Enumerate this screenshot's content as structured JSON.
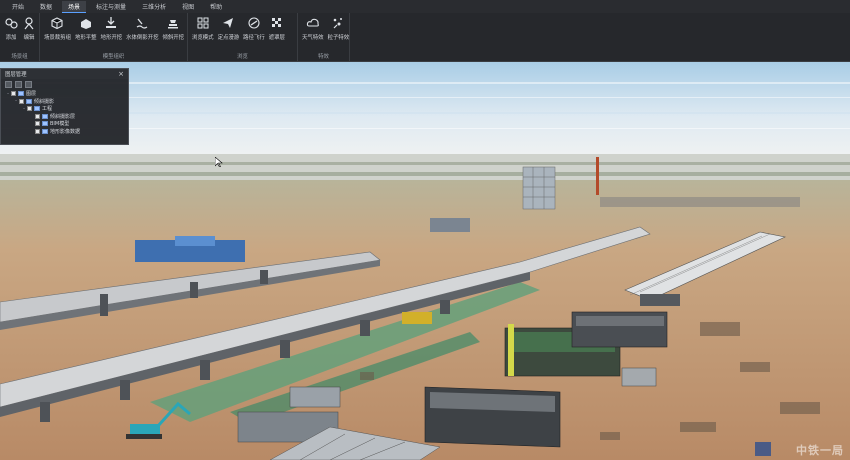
{
  "menu": {
    "tabs": [
      {
        "label": "开始",
        "active": false
      },
      {
        "label": "数据",
        "active": false
      },
      {
        "label": "场景",
        "active": true
      },
      {
        "label": "标注与测量",
        "active": false
      },
      {
        "label": "三维分析",
        "active": false
      },
      {
        "label": "视图",
        "active": false
      },
      {
        "label": "帮助",
        "active": false
      }
    ]
  },
  "ribbon": {
    "groups": [
      {
        "label": "场景组",
        "tools": [
          {
            "label": "添加",
            "icon": "add-scene-icon"
          },
          {
            "label": "编辑",
            "icon": "edit-scene-icon"
          }
        ]
      },
      {
        "label": "模型组织",
        "tools": [
          {
            "label": "场景裁剪组",
            "icon": "cube-clip-icon"
          },
          {
            "label": "地形平整",
            "icon": "terrain-flatten-icon"
          },
          {
            "label": "地形开挖",
            "icon": "terrain-excavate-icon"
          },
          {
            "label": "水体倒影开挖",
            "icon": "water-excavate-icon"
          },
          {
            "label": "倾斜开挖",
            "icon": "oblique-excavate-icon"
          }
        ]
      },
      {
        "label": "浏览",
        "tools": [
          {
            "label": "浏览模式",
            "icon": "browse-mode-icon"
          },
          {
            "label": "定点漫游",
            "icon": "point-roam-icon"
          },
          {
            "label": "路径飞行",
            "icon": "path-flight-icon"
          },
          {
            "label": "遮罩层",
            "icon": "mask-layer-icon"
          }
        ]
      },
      {
        "label": "特效",
        "tools": [
          {
            "label": "天气特效",
            "icon": "weather-effect-icon"
          },
          {
            "label": "粒子特效",
            "icon": "particle-effect-icon"
          }
        ]
      }
    ]
  },
  "layer_panel": {
    "title": "图层管理",
    "close": "×",
    "tree": [
      {
        "label": "图层",
        "level": 0,
        "twisty": "-"
      },
      {
        "label": "倾斜摄影",
        "level": 1,
        "twisty": "-"
      },
      {
        "label": "工程",
        "level": 2,
        "twisty": "-"
      },
      {
        "label": "倾斜摄影层",
        "level": 3,
        "twisty": ""
      },
      {
        "label": "BIM模型",
        "level": 3,
        "twisty": ""
      },
      {
        "label": "地形影像数据",
        "level": 3,
        "twisty": ""
      }
    ]
  },
  "watermark": "中铁一局",
  "colors": {
    "menubar_bg": "#2a2c30",
    "ribbon_bg": "#26282c",
    "sky_top": "#9ec4e0",
    "ground": "#c9a47e",
    "accent": "#5aa0ff"
  }
}
